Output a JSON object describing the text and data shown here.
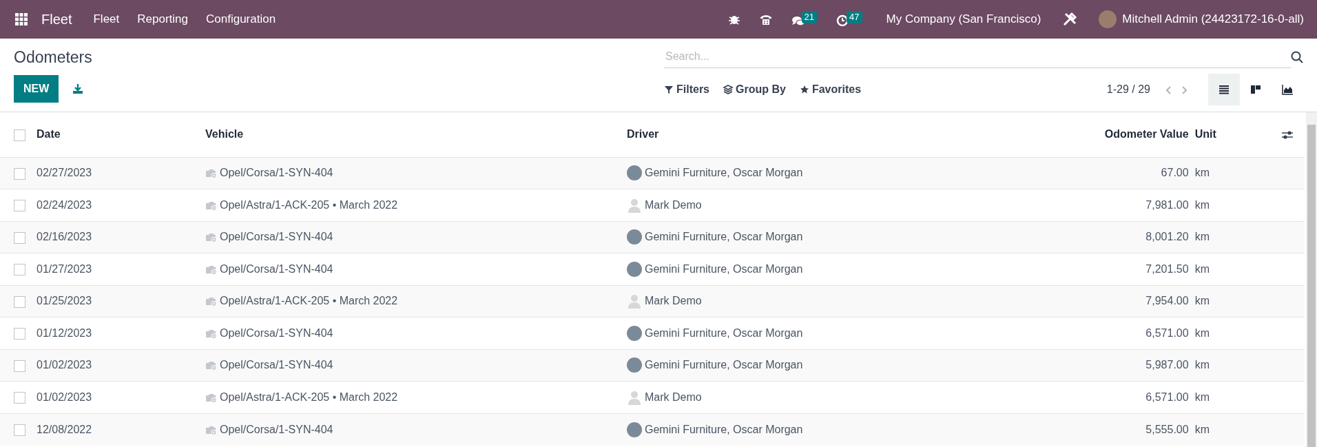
{
  "navbar": {
    "app_name": "Fleet",
    "menus": [
      "Fleet",
      "Reporting",
      "Configuration"
    ],
    "systray": [
      {
        "kind": "bug"
      },
      {
        "kind": "phone"
      },
      {
        "kind": "chat",
        "badge": "21"
      },
      {
        "kind": "activity",
        "badge": "47"
      }
    ],
    "company": "My Company (San Francisco)",
    "user": "Mitchell Admin (24423172-16-0-all)"
  },
  "control_panel": {
    "title": "Odometers",
    "new_button": "NEW",
    "search": {
      "placeholder": "Search..."
    },
    "filters": [
      "Filters",
      "Group By",
      "Favorites"
    ],
    "pager": "1-29 / 29",
    "views": [
      {
        "kind": "list",
        "selected": true
      },
      {
        "kind": "kanban",
        "selected": false
      },
      {
        "kind": "graph",
        "selected": false
      }
    ]
  },
  "table": {
    "select_all_checked": false,
    "columns": [
      "Date",
      "Vehicle",
      "Driver",
      "Odometer Value",
      "Unit"
    ],
    "rows": [
      {
        "checked": false,
        "date": "02/27/2023",
        "vehicle": "Opel/Corsa/1-SYN-404",
        "driver": "Gemini Furniture, Oscar Morgan",
        "kind": "photo",
        "value": "67.00",
        "unit": "km"
      },
      {
        "checked": false,
        "date": "02/24/2023",
        "vehicle": "Opel/Astra/1-ACK-205 • March 2022",
        "driver": "Mark Demo",
        "kind": "placeholder",
        "value": "7,981.00",
        "unit": "km"
      },
      {
        "checked": false,
        "date": "02/16/2023",
        "vehicle": "Opel/Corsa/1-SYN-404",
        "driver": "Gemini Furniture, Oscar Morgan",
        "kind": "photo",
        "value": "8,001.20",
        "unit": "km"
      },
      {
        "checked": false,
        "date": "01/27/2023",
        "vehicle": "Opel/Corsa/1-SYN-404",
        "driver": "Gemini Furniture, Oscar Morgan",
        "kind": "photo",
        "value": "7,201.50",
        "unit": "km"
      },
      {
        "checked": false,
        "date": "01/25/2023",
        "vehicle": "Opel/Astra/1-ACK-205 • March 2022",
        "driver": "Mark Demo",
        "kind": "placeholder",
        "value": "7,954.00",
        "unit": "km"
      },
      {
        "checked": false,
        "date": "01/12/2023",
        "vehicle": "Opel/Corsa/1-SYN-404",
        "driver": "Gemini Furniture, Oscar Morgan",
        "kind": "photo",
        "value": "6,571.00",
        "unit": "km"
      },
      {
        "checked": false,
        "date": "01/02/2023",
        "vehicle": "Opel/Corsa/1-SYN-404",
        "driver": "Gemini Furniture, Oscar Morgan",
        "kind": "photo",
        "value": "5,987.00",
        "unit": "km"
      },
      {
        "checked": false,
        "date": "01/02/2023",
        "vehicle": "Opel/Astra/1-ACK-205 • March 2022",
        "driver": "Mark Demo",
        "kind": "placeholder",
        "value": "6,571.00",
        "unit": "km"
      },
      {
        "checked": false,
        "date": "12/08/2022",
        "vehicle": "Opel/Corsa/1-SYN-404",
        "driver": "Gemini Furniture, Oscar Morgan",
        "kind": "photo",
        "value": "5,555.00",
        "unit": "km"
      }
    ]
  }
}
